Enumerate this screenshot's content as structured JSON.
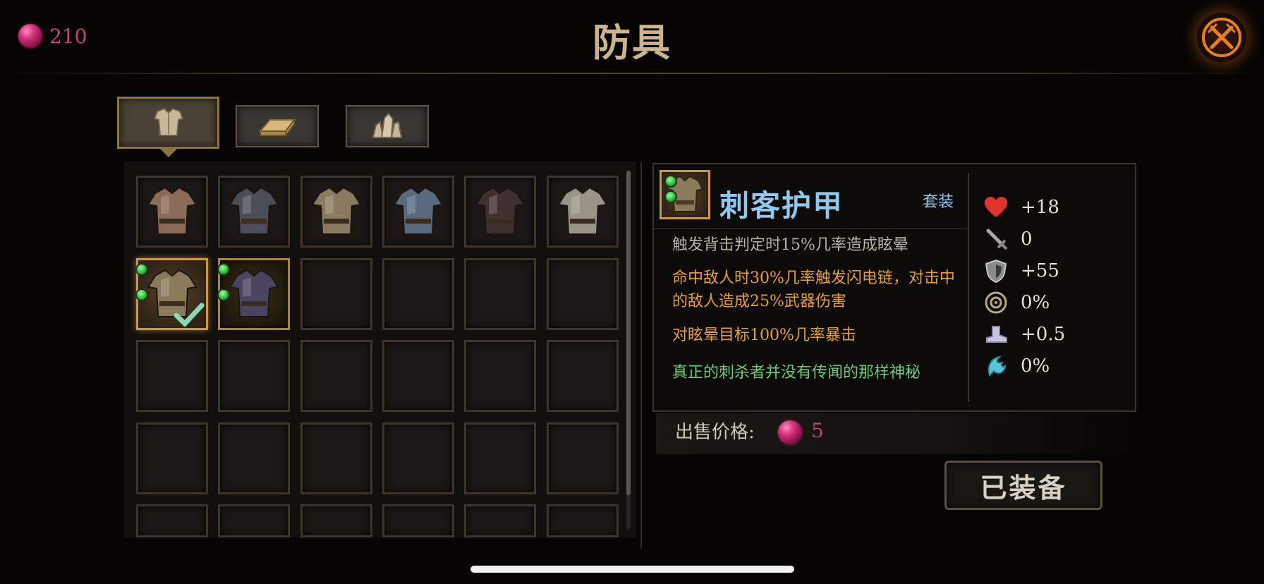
{
  "header": {
    "title": "防具",
    "currency": {
      "value": "210",
      "icon": "pink-gem-icon"
    },
    "close_icon": "crossed-swords-icon"
  },
  "tabs": [
    {
      "name": "armor",
      "icon": "breastplate-icon",
      "active": true
    },
    {
      "name": "material",
      "icon": "gold-bar-icon",
      "active": false
    },
    {
      "name": "gem",
      "icon": "crystal-icon",
      "active": false
    }
  ],
  "inventory": {
    "slots": [
      {
        "item": "leather-armor",
        "color": "#8a6a58"
      },
      {
        "item": "dark-plate-armor",
        "color": "#4a4e56"
      },
      {
        "item": "bronze-plate-armor",
        "color": "#8a7a60"
      },
      {
        "item": "blue-plate-armor",
        "color": "#5a6a7e"
      },
      {
        "item": "hooded-cloak-armor",
        "color": "#3e302c"
      },
      {
        "item": "silver-plate-armor",
        "color": "#9a9488"
      },
      {
        "item": "assassin-armor",
        "color": "#8a7a5a",
        "equipped": true,
        "sockets": 2
      },
      {
        "item": "shadow-armor",
        "color": "#4a4460",
        "rare": true,
        "sockets": 2
      }
    ]
  },
  "detail": {
    "name": "刺客护甲",
    "set_label": "套装",
    "descriptions": [
      "触发背击判定时15%几率造成眩晕",
      "命中敌人时30%几率触发闪电链，对击中的敌人造成25%武器伤害",
      "对眩晕目标100%几率暴击",
      "真正的刺杀者并没有传闻的那样神秘"
    ],
    "desc_colors": {
      "neutral": "#b8b0a2",
      "effect": "#e8a028",
      "flavor": "#6acb7a"
    },
    "stats": [
      {
        "icon": "heart-icon",
        "value": "+18"
      },
      {
        "icon": "sword-icon",
        "value": "0"
      },
      {
        "icon": "shield-icon",
        "value": "+55"
      },
      {
        "icon": "critical-target-icon",
        "value": "0%"
      },
      {
        "icon": "boot-icon",
        "value": "+0.5"
      },
      {
        "icon": "leech-icon",
        "value": "0%"
      }
    ]
  },
  "sell": {
    "label": "出售价格:",
    "value": "5"
  },
  "equip_button": {
    "label": "已装备"
  }
}
